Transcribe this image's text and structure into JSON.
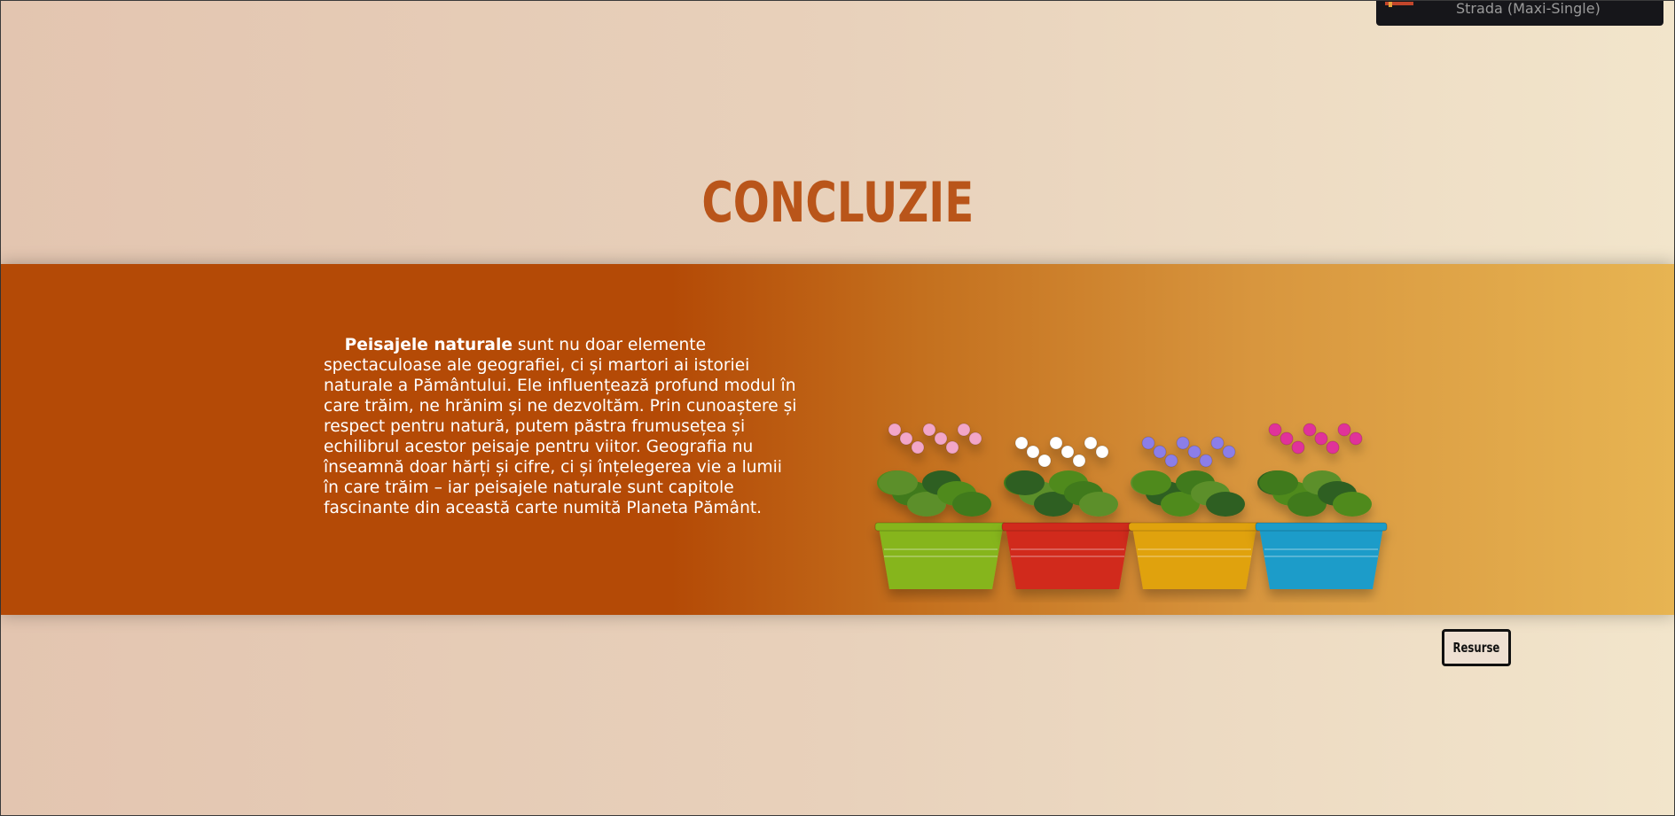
{
  "music_widget": {
    "title": "Strada (Maxi-Single)"
  },
  "page": {
    "title": "CONCLUZIE"
  },
  "content": {
    "lead": "Peisajele naturale",
    "body": " sunt nu doar elemente spectaculoase ale geografiei, ci și martori ai istoriei naturale a Pământului. Ele influențează profund modul în care trăim, ne hrănim și ne dezvoltăm. Prin cunoaștere și respect pentru natură, putem păstra frumusețea și echilibrul acestor peisaje pentru viitor. Geografia nu înseamnă doar hărți și cifre, ci și înțelegerea vie a lumii în care trăim – iar peisajele naturale sunt capitole fascinante din această carte numită Planeta Pământ."
  },
  "image": {
    "name": "flower-pots-image",
    "pot_colors": [
      "#86b51e",
      "#d12a1f",
      "#e0a20c",
      "#1e9cc9"
    ]
  },
  "buttons": {
    "resurse_label": "Resurse"
  }
}
